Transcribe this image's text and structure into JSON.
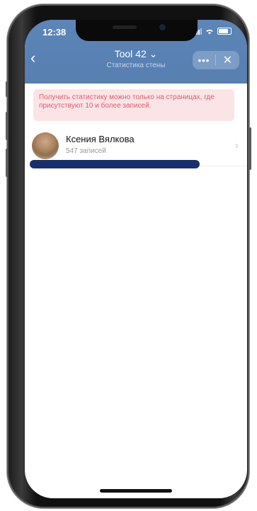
{
  "status_bar": {
    "time": "12:38"
  },
  "header": {
    "title": "Tool 42 ⌄",
    "subtitle": "Статистика стены",
    "back_icon": "‹",
    "more_icon": "•••",
    "close_icon": "✕"
  },
  "notice": {
    "text": "Получить статистику можно только на страницах, где присутствуют 10 и более записей."
  },
  "user": {
    "name": "Ксения Вялкова",
    "count": "547 записей",
    "chevron": "›"
  },
  "colors": {
    "header_bg": "#5b82b4",
    "notice_bg": "#fbe4e6",
    "notice_text": "#e25b6a",
    "redaction": "#172f6c"
  }
}
